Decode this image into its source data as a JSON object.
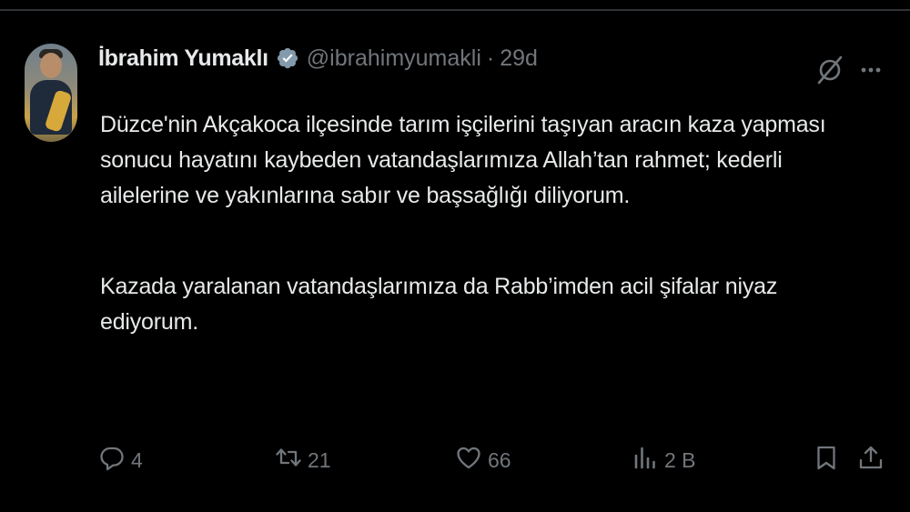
{
  "tweet": {
    "author_name": "İbrahim Yumaklı",
    "handle": "@ibrahimyumakli",
    "separator": "·",
    "time": "29d",
    "paragraph1": "Düzce'nin Akçakoca ilçesinde tarım işçilerini taşıyan aracın kaza yapması sonucu hayatını kaybeden vatandaşlarımıza Allah’tan rahmet; kederli ailelerine ve yakınlarına sabır ve başsağlığı diliyorum.",
    "paragraph2": "Kazada yaralanan vatandaşlarımıza da Rabb’imden acil şifalar niyaz ediyorum."
  },
  "actions": {
    "replies": "4",
    "reposts": "21",
    "likes": "66",
    "views": "2 B"
  },
  "icons": {
    "verified": "verified-badge-icon",
    "grok": "grok-icon",
    "more": "more-icon",
    "reply": "reply-icon",
    "repost": "repost-icon",
    "like": "heart-icon",
    "views": "views-icon",
    "bookmark": "bookmark-icon",
    "share": "share-icon"
  },
  "colors": {
    "background": "#000000",
    "text": "#e7e9ea",
    "muted": "#71767b",
    "verified_badge": "#829aab"
  }
}
